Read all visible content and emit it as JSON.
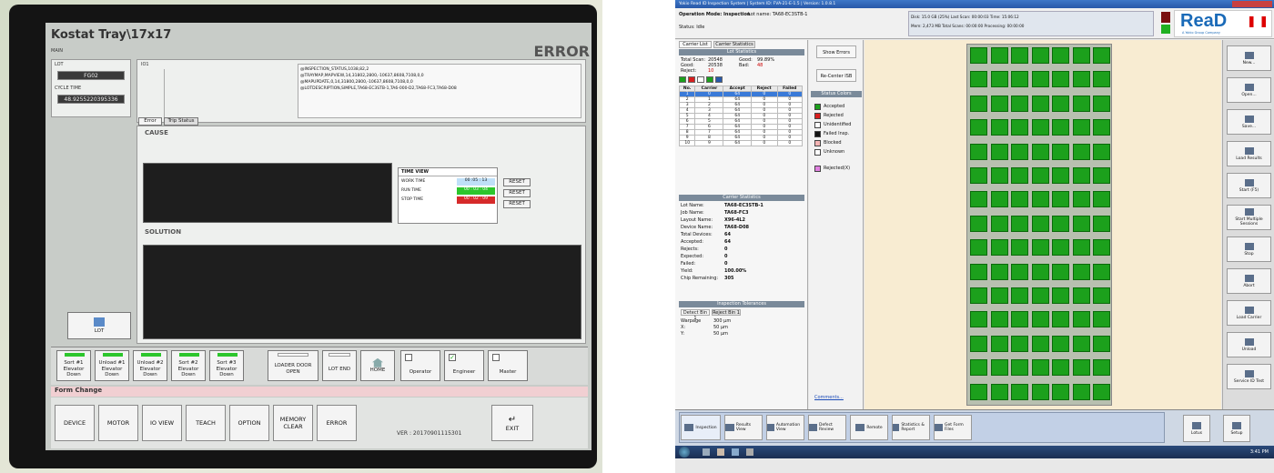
{
  "left": {
    "title": "Kostat Tray\\17x17",
    "mode_label": "MAIN",
    "status": "ERROR",
    "lot_label": "LOT",
    "lot_value": "FG02",
    "cycle_label": "CYCLE TIME",
    "cycle_value": "48.9255220395336",
    "io_label": "IO1",
    "log_lines": [
      "@INSPECTION_STATUS,1038,82,2",
      "@TRAYMAP,MAPVIEW,14,31802,2800,-10637,8608,7108,0,0",
      "@MAPUPDATE,0,14,31800,2800,-10637,8608,7108,0,0",
      "@LOTDESCRIPTION,SIMPLE,TA68-EC3STB-1,TA6-000-D2,TA68-FC3,TA68-D08"
    ],
    "tabs": [
      "Error",
      "Trip Status"
    ],
    "cause_label": "CAUSE",
    "solution_label": "SOLUTION",
    "time_view": {
      "title": "TIME VIEW",
      "rows": [
        {
          "label": "WORK TIME",
          "value": "00 :05 : 13"
        },
        {
          "label": "RUN TIME",
          "value": "00 : 03 : 04"
        },
        {
          "label": "STOP TIME",
          "value": "00 : 02 : 09"
        }
      ],
      "buttons": [
        "RESET",
        "RESET",
        "RESET"
      ]
    },
    "lot_button": "LOT",
    "status_buttons": [
      "Sort #1\nElevator\nDown",
      "Unload #1\nElevator\nDown",
      "Unload #2\nElevator\nDown",
      "Sort #2\nElevator\nDown",
      "Sort #3\nElevator\nDown"
    ],
    "door_button": "LOADER DOOR\nOPEN",
    "lotend_button": "LOT END",
    "home_button": "HOME",
    "operator_button": "Operator",
    "engineer_button": "Engineer",
    "master_button": "Master",
    "form_change": "Form Change",
    "bottom_buttons": [
      "DEVICE",
      "MOTOR",
      "IO VIEW",
      "TEACH",
      "OPTION",
      "MEMORY\nCLEAR",
      "ERROR"
    ],
    "version": "VER : 20170901115301",
    "exit_button": "EXIT"
  },
  "right": {
    "window_title": "Yokio  Read ID Inspection System  |  System ID: FVA-21-E-1.5  |  Version: 1.0.8.1",
    "operation_mode": "Operation Mode: Inspection",
    "lot_name_hdr": "Lot name: TA68-EC3STB-1",
    "status_idle": "Status: Idle",
    "info": {
      "line1": "Disk: 15.0 GB (25%)   Last Scan: 00:00:03   Time: 15:06:12",
      "line2": "Mem: 2,473 MB   Total Scans: 00:00:00   Processing: 00:00:00"
    },
    "logo": "ReaD",
    "logo_sub": "A Yokio Group Company",
    "tabs": [
      "Carrier List",
      "Carrier Statistics"
    ],
    "lot_stats_title": "Lot Statistics",
    "lot_stats": [
      {
        "k": "Total Scan:",
        "v": "20548",
        "k2": "Good:",
        "v2": "99.89%"
      },
      {
        "k": "Good:",
        "v": "20538",
        "k2": "Bad:",
        "v2": "48"
      },
      {
        "k": "Reject:",
        "v": "10",
        "k2": "",
        "v2": ""
      }
    ],
    "table_headers": [
      "No.",
      "Carrier",
      "Accept",
      "Reject",
      "Failed"
    ],
    "table_rows": [
      [
        "1",
        "0",
        "64",
        "0",
        "0"
      ],
      [
        "2",
        "1",
        "64",
        "0",
        "0"
      ],
      [
        "3",
        "2",
        "64",
        "0",
        "0"
      ],
      [
        "4",
        "3",
        "64",
        "0",
        "0"
      ],
      [
        "5",
        "4",
        "64",
        "0",
        "0"
      ],
      [
        "6",
        "5",
        "64",
        "0",
        "0"
      ],
      [
        "7",
        "6",
        "64",
        "0",
        "0"
      ],
      [
        "8",
        "7",
        "64",
        "0",
        "0"
      ],
      [
        "9",
        "8",
        "64",
        "0",
        "0"
      ],
      [
        "10",
        "9",
        "64",
        "0",
        "0"
      ]
    ],
    "carrier_stats_title": "Carrier Statistics",
    "carrier_stats": [
      {
        "k": "Lot Name:",
        "v": "TA68-EC3STB-1"
      },
      {
        "k": "Job Name:",
        "v": "TA68-FC3"
      },
      {
        "k": "Layout Name:",
        "v": "X96-4L2"
      },
      {
        "k": "Device Name:",
        "v": "TA68-D08"
      },
      {
        "k": "Total Devices:",
        "v": "64"
      },
      {
        "k": "   Accepted:",
        "v": "64"
      },
      {
        "k": "   Rejects:",
        "v": "0"
      },
      {
        "k": "   Expected:",
        "v": "0"
      },
      {
        "k": "   Failed:",
        "v": "0"
      },
      {
        "k": "Yield:",
        "v": "100.00%"
      },
      {
        "k": "Chip Remaining:",
        "v": "305"
      }
    ],
    "tolerance_title": "Inspection Tolerances",
    "tolerance_tabs": [
      "Detect Bin 1",
      "Reject Bin 1"
    ],
    "tolerances": [
      {
        "k": "Warpage",
        "v": "300 µm"
      },
      {
        "k": "X:",
        "v": "50 µm"
      },
      {
        "k": "Y:",
        "v": "50 µm"
      }
    ],
    "comments_link": "Comments...",
    "mid_buttons": [
      "Show Errors",
      "Re-Center ISB"
    ],
    "status_colors_title": "Status Colors",
    "status_colors": [
      {
        "label": "Accepted",
        "color": "#1ca01c"
      },
      {
        "label": "Rejected",
        "color": "#d81e1e"
      },
      {
        "label": "Unidentified",
        "color": "#ffffff"
      },
      {
        "label": "Failed Insp.",
        "color": "#111111"
      },
      {
        "label": "Blocked",
        "color": "#f4b4b4"
      },
      {
        "label": "Unknown",
        "color": "#ffffff"
      },
      {
        "label": "Rejected(X)",
        "color": "#e080e0"
      }
    ],
    "side_buttons": [
      "New...",
      "Open...",
      "Save...",
      "Load Results",
      "Start (F5)",
      "Start Multiple Sessions",
      "Stop",
      "Abort",
      "Load Carrier",
      "Unload",
      "Service ID Test"
    ],
    "bottom_tabs": [
      "Inspection",
      "Results View",
      "Automation View",
      "Defect Review",
      "Remote",
      "Statistics & Report",
      "Get Form Files"
    ],
    "bottom_right": [
      "Lotus",
      "Setup"
    ],
    "taskbar_time": "3:41 PM",
    "tray_cols": 7,
    "tray_rows": 15
  }
}
